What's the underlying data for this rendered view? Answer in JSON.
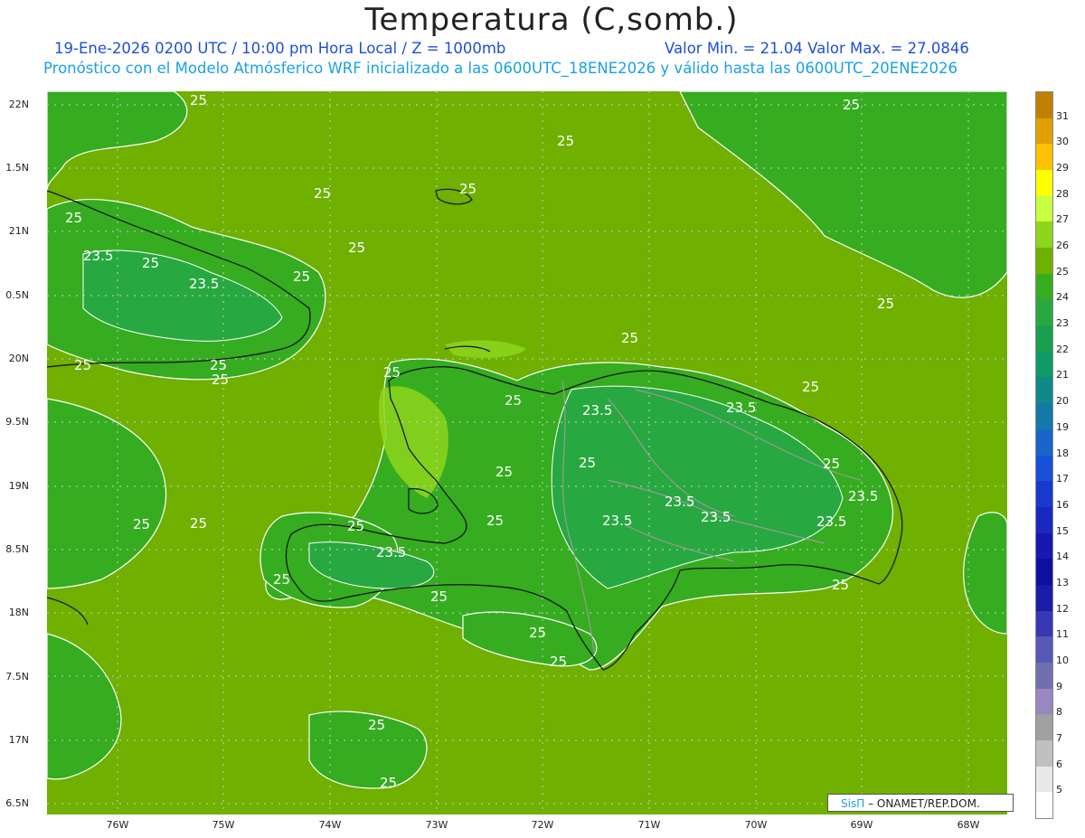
{
  "title": "Temperatura (C,somb.)",
  "subtitle_line1": "19-Ene-2026 0200 UTC / 10:00 pm Hora Local / Z = 1000mb",
  "subtitle_minmax": "Valor Min. = 21.04  Valor Max. = 27.0846",
  "subtitle_line2": "Pronóstico con el Modelo Atmósferico WRF inicializado a las 0600UTC_18ENE2026 y válido hasta las  0600UTC_20ENE2026",
  "y_axis_labels": [
    "22N",
    "1.5N",
    "21N",
    "0.5N",
    "20N",
    "9.5N",
    "19N",
    "8.5N",
    "18N",
    "7.5N",
    "17N",
    "6.5N"
  ],
  "x_axis_labels": [
    "76W",
    "75W",
    "74W",
    "73W",
    "72W",
    "71W",
    "70W",
    "69W",
    "68W"
  ],
  "colorbar": {
    "labels": [
      "31",
      "30",
      "29",
      "28",
      "27",
      "26",
      "25",
      "24",
      "23",
      "22",
      "21",
      "20",
      "19",
      "18",
      "17",
      "16",
      "15",
      "14",
      "13",
      "12",
      "11",
      "10",
      "9",
      "8",
      "7",
      "6",
      "5"
    ],
    "colors": [
      "#c08000",
      "#e0a000",
      "#ffc000",
      "#ffff00",
      "#c8ff40",
      "#8ed61c",
      "#6fb000",
      "#36ac20",
      "#28a840",
      "#18a050",
      "#109a68",
      "#108a88",
      "#1478a8",
      "#1864c8",
      "#1850d8",
      "#1838d0",
      "#1828c0",
      "#1818b0",
      "#1010a0",
      "#1c1ca8",
      "#3838b4",
      "#5858b8",
      "#7070b0",
      "#9a86c0",
      "#a0a0a0",
      "#c0c0c0",
      "#e8e8e8",
      "#ffffff"
    ]
  },
  "contour_labels": [
    "25",
    "25",
    "25",
    "25",
    "25",
    "25",
    "25",
    "25",
    "25",
    "25",
    "25",
    "25",
    "25",
    "25",
    "25",
    "25",
    "25",
    "25",
    "25",
    "25",
    "25",
    "25",
    "25",
    "25",
    "25",
    "25",
    "25",
    "25",
    "25",
    "25",
    "25",
    "23.5",
    "23.5",
    "23.5",
    "23.5",
    "23.5",
    "23.5",
    "23.5",
    "23.5",
    "23.5",
    "23.5"
  ],
  "credit": {
    "logo": "SisΠ",
    "text": "– ONAMET/REP.DOM."
  }
}
